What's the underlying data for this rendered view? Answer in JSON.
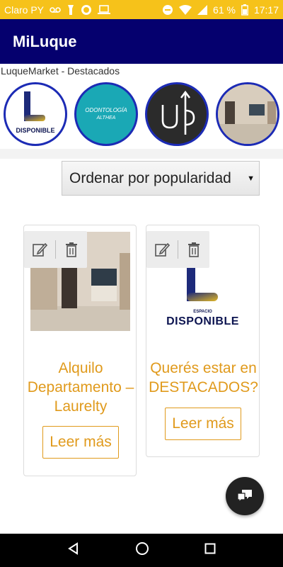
{
  "status_bar": {
    "carrier": "Claro PY",
    "battery_percent": "61 %",
    "time": "17:17",
    "icons": [
      "voicemail-icon",
      "torch-icon",
      "sync-icon",
      "laptop-icon",
      "dnd-icon",
      "wifi-icon",
      "signal-icon",
      "battery-icon"
    ]
  },
  "app_bar": {
    "title": "MiLuque"
  },
  "featured": {
    "title": "LuqueMarket - Destacados",
    "stories": [
      {
        "name": "disponible-logo",
        "label": "DISPONIBLE"
      },
      {
        "name": "odontologia-althea",
        "label": "ODONTOLOGÍA",
        "sublabel": "ALTHEA"
      },
      {
        "name": "up-logo",
        "label": "Up"
      },
      {
        "name": "apartment-photo",
        "label": ""
      }
    ]
  },
  "sort": {
    "selected": "Ordenar por popularidad"
  },
  "cards": [
    {
      "title_lines": [
        "Alquilo",
        "Departamento –",
        "Laurelty"
      ],
      "button": "Leer más"
    },
    {
      "title_lines": [
        "Querés estar en",
        "DESTACADOS?"
      ],
      "button": "Leer más",
      "image_small": "ESPACIO",
      "image_big": "DISPONIBLE"
    }
  ],
  "colors": {
    "status_bar": "#f6c21a",
    "app_bar": "#05006e",
    "accent": "#e09a1c",
    "story_ring": "#1c2bb5"
  }
}
